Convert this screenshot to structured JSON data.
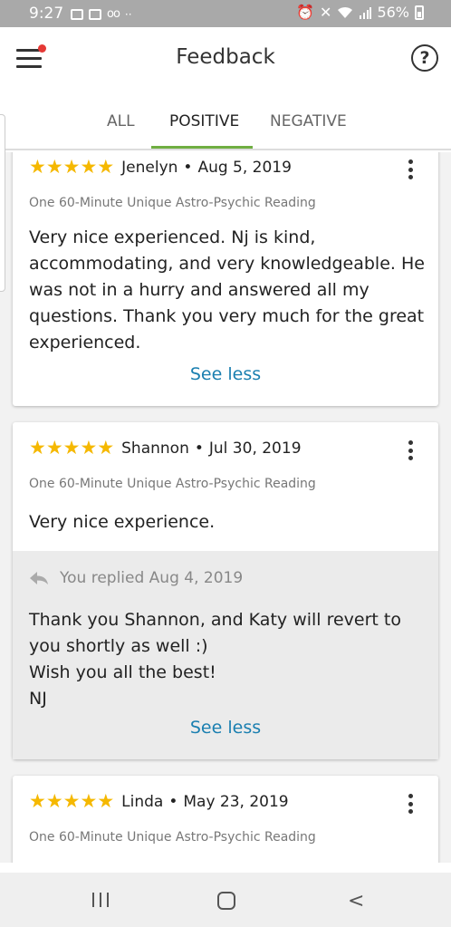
{
  "status_bar": {
    "time": "9:27",
    "left_icons": [
      "image-icon",
      "mail-icon",
      "voicemail-icon",
      "more-dots-icon"
    ],
    "right_icons": [
      "alarm-icon",
      "mute-icon",
      "wifi-icon",
      "signal-icon"
    ],
    "battery": "56%"
  },
  "app_bar": {
    "title": "Feedback",
    "help_label": "?"
  },
  "tabs": [
    {
      "label": "ALL",
      "active": false
    },
    {
      "label": "POSITIVE",
      "active": true
    },
    {
      "label": "NEGATIVE",
      "active": false
    }
  ],
  "accent_color": "#6fae42",
  "link_color": "#1a7fb0",
  "star_color": "#f5b800",
  "reviews": [
    {
      "stars": 5,
      "reviewer": "Jenelyn",
      "separator": "•",
      "date": "Aug 5, 2019",
      "product": "One 60-Minute Unique Astro-Psychic Reading",
      "text": "Very  nice experienced.  Nj is kind, accommodating, and very knowledgeable. He was not in a hurry and answered all my questions.  Thank you very much for the great experienced.",
      "see_less": "See less"
    },
    {
      "stars": 5,
      "reviewer": "Shannon",
      "separator": "•",
      "date": "Jul 30, 2019",
      "product": "One 60-Minute Unique Astro-Psychic Reading",
      "text": "Very nice experience.",
      "reply": {
        "meta": "You replied Aug 4, 2019",
        "text": "Thank you Shannon, and Katy will revert to you shortly as well :)\nWish you all the best!\nNJ",
        "see_less": "See less"
      }
    },
    {
      "stars": 5,
      "reviewer": "Linda",
      "separator": "•",
      "date": "May 23, 2019",
      "product": "One 60-Minute Unique Astro-Psychic Reading"
    }
  ],
  "nav_bar": {
    "recent": "recent-apps",
    "home": "home",
    "back": "<"
  }
}
